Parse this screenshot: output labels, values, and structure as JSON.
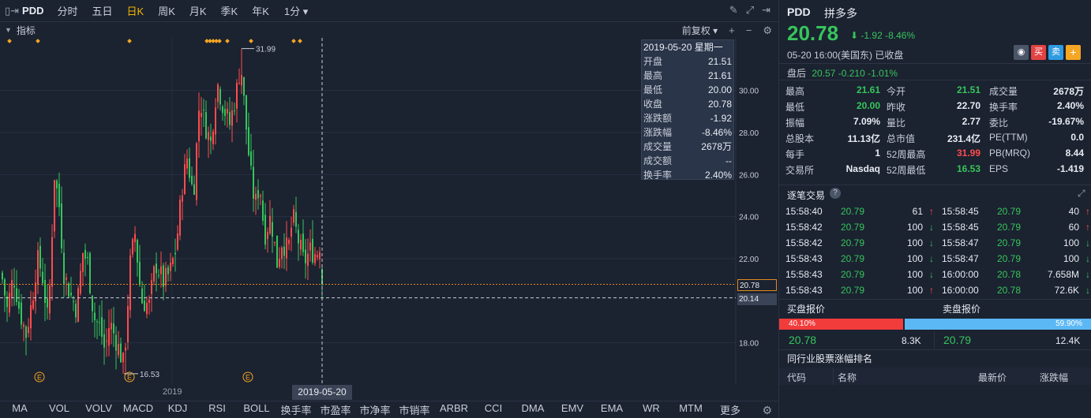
{
  "topbar": {
    "symbol": "PDD",
    "periods": [
      "分时",
      "五日",
      "日K",
      "周K",
      "月K",
      "季K",
      "年K"
    ],
    "active_period": "日K",
    "interval": "1分 ▾",
    "icons": [
      "pencil-icon",
      "expand-icon",
      "sidebar-toggle-icon"
    ]
  },
  "indicator_bar": {
    "label": "指标",
    "adjust": "前复权 ▾"
  },
  "chart": {
    "annotation_high": "31.99",
    "annotation_low": "16.53",
    "year_label": "2019",
    "crosshair_date": "2019-05-20",
    "current_price_label": "20.78",
    "crosshair_price_label": "20.14",
    "event_marker": "E"
  },
  "chart_data": {
    "type": "candlestick",
    "ylim": [
      16.0,
      32.5
    ],
    "y_ticks": [
      "30.00",
      "28.00",
      "26.00",
      "24.00",
      "22.00",
      "18.00"
    ],
    "high": 31.99,
    "low": 16.53,
    "last": 20.78,
    "crosshair_value": 20.14
  },
  "infobox": {
    "date": "2019-05-20 星期一",
    "rows": [
      {
        "k": "开盘",
        "v": "21.51",
        "c": "green"
      },
      {
        "k": "最高",
        "v": "21.61",
        "c": "green"
      },
      {
        "k": "最低",
        "v": "20.00",
        "c": "green"
      },
      {
        "k": "收盘",
        "v": "20.78",
        "c": "green"
      },
      {
        "k": "涨跌额",
        "v": "-1.92",
        "c": "green"
      },
      {
        "k": "涨跌幅",
        "v": "-8.46%",
        "c": "green"
      },
      {
        "k": "成交量",
        "v": "2678万",
        "c": "white"
      },
      {
        "k": "成交额",
        "v": "--",
        "c": "white"
      },
      {
        "k": "换手率",
        "v": "2.40%",
        "c": "white"
      }
    ]
  },
  "bottom_indicators": [
    "MA",
    "VOL",
    "VOLV",
    "MACD",
    "KDJ",
    "RSI",
    "BOLL",
    "换手率",
    "市盈率",
    "市净率",
    "市销率",
    "ARBR",
    "CCI",
    "DMA",
    "EMV",
    "EMA",
    "WR",
    "MTM",
    "更多"
  ],
  "quote": {
    "symbol": "PDD",
    "name": "拼多多",
    "price": "20.78",
    "change": "⬇ -1.92  -8.46%",
    "time": "05-20  16:00(美国东)  已收盘",
    "after_label": "盘后",
    "after_vals": "20.57  -0.210  -1.01%",
    "buttons": {
      "buy": "买",
      "sell": "卖",
      "add": "+",
      "bell": "◉"
    },
    "grid": [
      [
        {
          "k": "最高",
          "v": "21.61",
          "c": "green"
        },
        {
          "k": "今开",
          "v": "21.51",
          "c": "green"
        },
        {
          "k": "成交量",
          "v": "2678万",
          "c": "white"
        }
      ],
      [
        {
          "k": "最低",
          "v": "20.00",
          "c": "green"
        },
        {
          "k": "昨收",
          "v": "22.70",
          "c": "white"
        },
        {
          "k": "换手率",
          "v": "2.40%",
          "c": "white"
        }
      ],
      [
        {
          "k": "振幅",
          "v": "7.09%",
          "c": "white"
        },
        {
          "k": "量比",
          "v": "2.77",
          "c": "white"
        },
        {
          "k": "委比",
          "v": "-19.67%",
          "c": "white"
        }
      ],
      [
        {
          "k": "总股本",
          "v": "11.13亿",
          "c": "white"
        },
        {
          "k": "总市值",
          "v": "231.4亿",
          "c": "white"
        },
        {
          "k": "PE(TTM)",
          "v": "0.0",
          "c": "white"
        }
      ],
      [
        {
          "k": "每手",
          "v": "1",
          "c": "white"
        },
        {
          "k": "52周最高",
          "v": "31.99",
          "c": "red"
        },
        {
          "k": "PB(MRQ)",
          "v": "8.44",
          "c": "white"
        }
      ],
      [
        {
          "k": "交易所",
          "v": "Nasdaq",
          "c": "white"
        },
        {
          "k": "52周最低",
          "v": "16.53",
          "c": "green"
        },
        {
          "k": "EPS",
          "v": "-1.419",
          "c": "white"
        }
      ]
    ]
  },
  "ticks": {
    "title": "逐笔交易",
    "left": [
      {
        "t": "15:58:40",
        "p": "20.79",
        "q": "61",
        "d": "up"
      },
      {
        "t": "15:58:42",
        "p": "20.79",
        "q": "100",
        "d": "dn"
      },
      {
        "t": "15:58:42",
        "p": "20.79",
        "q": "100",
        "d": "dn"
      },
      {
        "t": "15:58:43",
        "p": "20.79",
        "q": "100",
        "d": "dn"
      },
      {
        "t": "15:58:43",
        "p": "20.79",
        "q": "100",
        "d": "dn"
      },
      {
        "t": "15:58:43",
        "p": "20.79",
        "q": "100",
        "d": "up"
      }
    ],
    "right": [
      {
        "t": "15:58:45",
        "p": "20.79",
        "q": "40",
        "d": "up"
      },
      {
        "t": "15:58:45",
        "p": "20.79",
        "q": "60",
        "d": "up"
      },
      {
        "t": "15:58:47",
        "p": "20.79",
        "q": "100",
        "d": "dn"
      },
      {
        "t": "15:58:47",
        "p": "20.79",
        "q": "100",
        "d": "dn"
      },
      {
        "t": "16:00:00",
        "p": "20.78",
        "q": "7.658M",
        "d": "dn"
      },
      {
        "t": "16:00:00",
        "p": "20.78",
        "q": "72.6K",
        "d": "dn"
      }
    ]
  },
  "bidask": {
    "bid_title": "买盘报价",
    "ask_title": "卖盘报价",
    "bid_pct": "40.10%",
    "ask_pct": "59.90%",
    "bid_fraction": 0.401,
    "bid_price": "20.78",
    "bid_size": "8.3K",
    "ask_price": "20.79",
    "ask_size": "12.4K"
  },
  "peers": {
    "title": "同行业股票涨幅排名",
    "headers": [
      "代码",
      "名称",
      "最新价",
      "涨跌幅"
    ]
  }
}
